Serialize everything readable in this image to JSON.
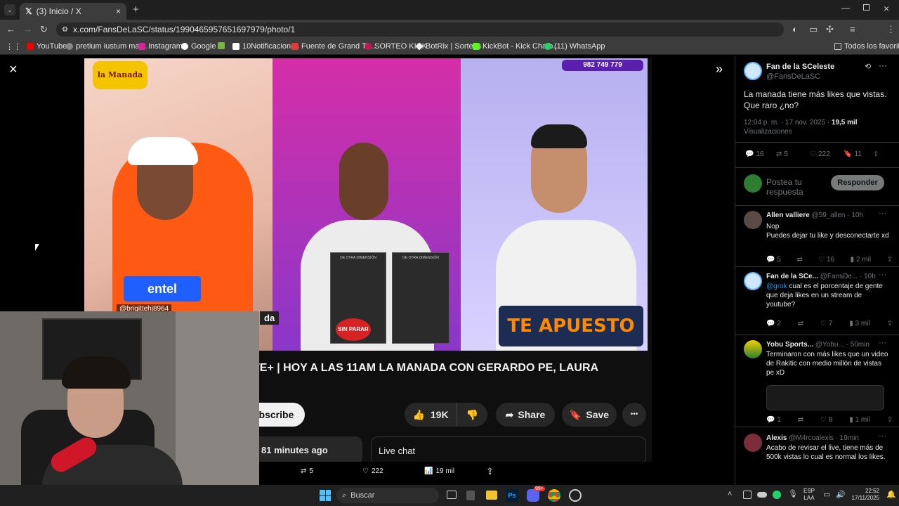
{
  "browser": {
    "tab_title": "(3) Inicio / X",
    "url": "x.com/FansDeLaSC/status/1990465957651697979/photo/1",
    "new_tab": "+",
    "bookmarks": [
      "YouTube",
      "pretium iustum mat...",
      "Instagram",
      "Google",
      "",
      "10Notificaciones",
      "Fuente de Grand Th...",
      "SORTEO KICK",
      "BotRix | Sorteos",
      "KickBot - Kick Chatb...",
      "(11) WhatsApp"
    ],
    "all_bookmarks": "Todos los favoritos"
  },
  "viewer": {
    "close_icon": "×",
    "expand_icon": "»",
    "stats": {
      "retweets": "5",
      "likes": "222",
      "views": "19 mil"
    }
  },
  "youtube": {
    "logo_text": "la Manada",
    "phone": "982 749 779",
    "sponsor": "entel",
    "username": "@brigittehj8964",
    "partial_label": "da",
    "product1": "SIN PARAR",
    "product_top": "DE OTRA DIMENSIÓN",
    "brand": "TE APUESTO",
    "title": "TE+ | HOY A LAS 11AM LA MANADA CON GERARDO PE, LAURA",
    "subscribe": "ubscribe",
    "likes": "19K",
    "share": "Share",
    "save": "Save",
    "more": "•••",
    "time_ago": "81 minutes ago",
    "live_chat": "Live chat"
  },
  "tweet": {
    "author": "Fan de la SCeleste",
    "handle": "@FansDeLaSC",
    "text": "La manada tiene más likes que vistas. Que raro ¿no?",
    "time": "12:04 p. m. · 17 nov. 2025 ·",
    "views": "19,5 mil",
    "views_label": "Visualizaciones",
    "replies": "16",
    "retweets": "5",
    "likes": "222",
    "bookmarks": "11",
    "reply_placeholder": "Postea tu respuesta",
    "reply_button": "Responder"
  },
  "replies": [
    {
      "name": "Allen valliere",
      "handle": "@59_allen · 10h",
      "text": "Nop\nPuedes dejar tu like y desconectarte xd",
      "r": "5",
      "rt": "",
      "l": "16",
      "v": "2 mil"
    },
    {
      "name": "Fan de la SCe...",
      "handle": "@FansDe... · 10h",
      "mention": "@grok",
      "text": " cual es el porcentaje de gente que deja likes en un stream de youtube?",
      "r": "2",
      "rt": "",
      "l": "7",
      "v": "3 mil"
    },
    {
      "name": "Yobu Sports...",
      "handle": "@Yobu... · 50min",
      "text": "Terminaron con más likes que un video de Rakitic con medio millón de vistas pe xD",
      "r": "1",
      "rt": "",
      "l": "8",
      "v": "1 mil"
    },
    {
      "name": "Alexis",
      "handle": "@M4rcoalexis · 19min",
      "text": "Acabo de revisar el live, tiene más de 500k vistas lo cual es normal los likes.",
      "r": "",
      "rt": "",
      "l": "",
      "v": ""
    }
  ],
  "taskbar": {
    "search": "Buscar",
    "lang1": "ESP",
    "lang2": "LAA",
    "time": "22:52",
    "date": "17/11/2025",
    "badge": "99+"
  },
  "colors": {
    "x_bg": "#000000",
    "accent": "#1d9bf0",
    "chrome": "#3c3c3c",
    "taskbar": "#202020"
  }
}
